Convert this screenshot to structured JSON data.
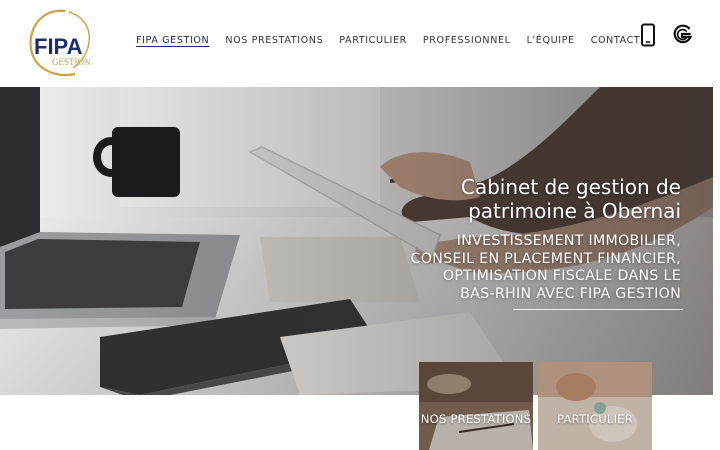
{
  "logo": {
    "text": "FIPA",
    "subtext": "GESTION"
  },
  "nav": {
    "items": [
      {
        "label": "FIPA GESTION",
        "active": true
      },
      {
        "label": "NOS PRESTATIONS",
        "active": false
      },
      {
        "label": "PARTICULIER",
        "active": false
      },
      {
        "label": "PROFESSIONNEL",
        "active": false
      },
      {
        "label": "L'ÉQUIPE",
        "active": false
      },
      {
        "label": "CONTACT",
        "active": false
      }
    ]
  },
  "header_icons": {
    "phone": "mobile-phone-icon",
    "google": "google-icon"
  },
  "hero": {
    "title_line1": "Cabinet de gestion de",
    "title_line2": "patrimoine à Obernai",
    "subtitle_line1": "INVESTISSEMENT IMMOBILIER,",
    "subtitle_line2": "CONSEIL EN PLACEMENT FINANCIER,",
    "subtitle_line3": "OPTIMISATION FISCALE DANS LE",
    "subtitle_line4": "BAS-RHIN AVEC FIPA GESTION"
  },
  "cards": [
    {
      "label": "NOS PRESTATIONS"
    },
    {
      "label": "PARTICULIER"
    }
  ],
  "colors": {
    "brand_navy": "#1d2f6b",
    "brand_gold": "#c9a24a",
    "nav_text": "#333333"
  }
}
